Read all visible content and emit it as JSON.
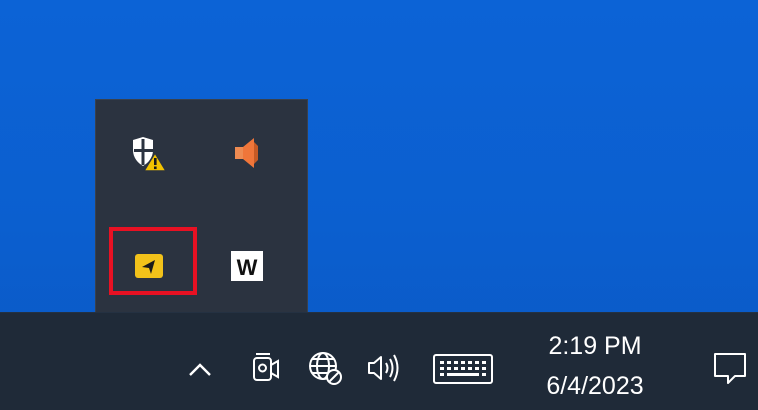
{
  "desktop": {
    "background_color": "#0b5fcf"
  },
  "tray_flyout": {
    "icons": [
      {
        "name": "windows-security-warning-icon",
        "interactable": true
      },
      {
        "name": "volume-muted-icon",
        "interactable": true
      },
      {
        "name": "yellow-app-arrow-icon",
        "interactable": true,
        "highlighted": true
      },
      {
        "name": "w-app-icon",
        "label": "W",
        "interactable": true
      }
    ],
    "highlight_color": "#e81123"
  },
  "taskbar": {
    "icons": [
      "show-hidden-icons-chevron-icon",
      "meet-now-icon",
      "network-no-internet-icon",
      "speaker-icon",
      "touch-keyboard-icon",
      "notification-center-icon"
    ],
    "clock": {
      "time": "2:19 PM",
      "date": "6/4/2023"
    }
  }
}
